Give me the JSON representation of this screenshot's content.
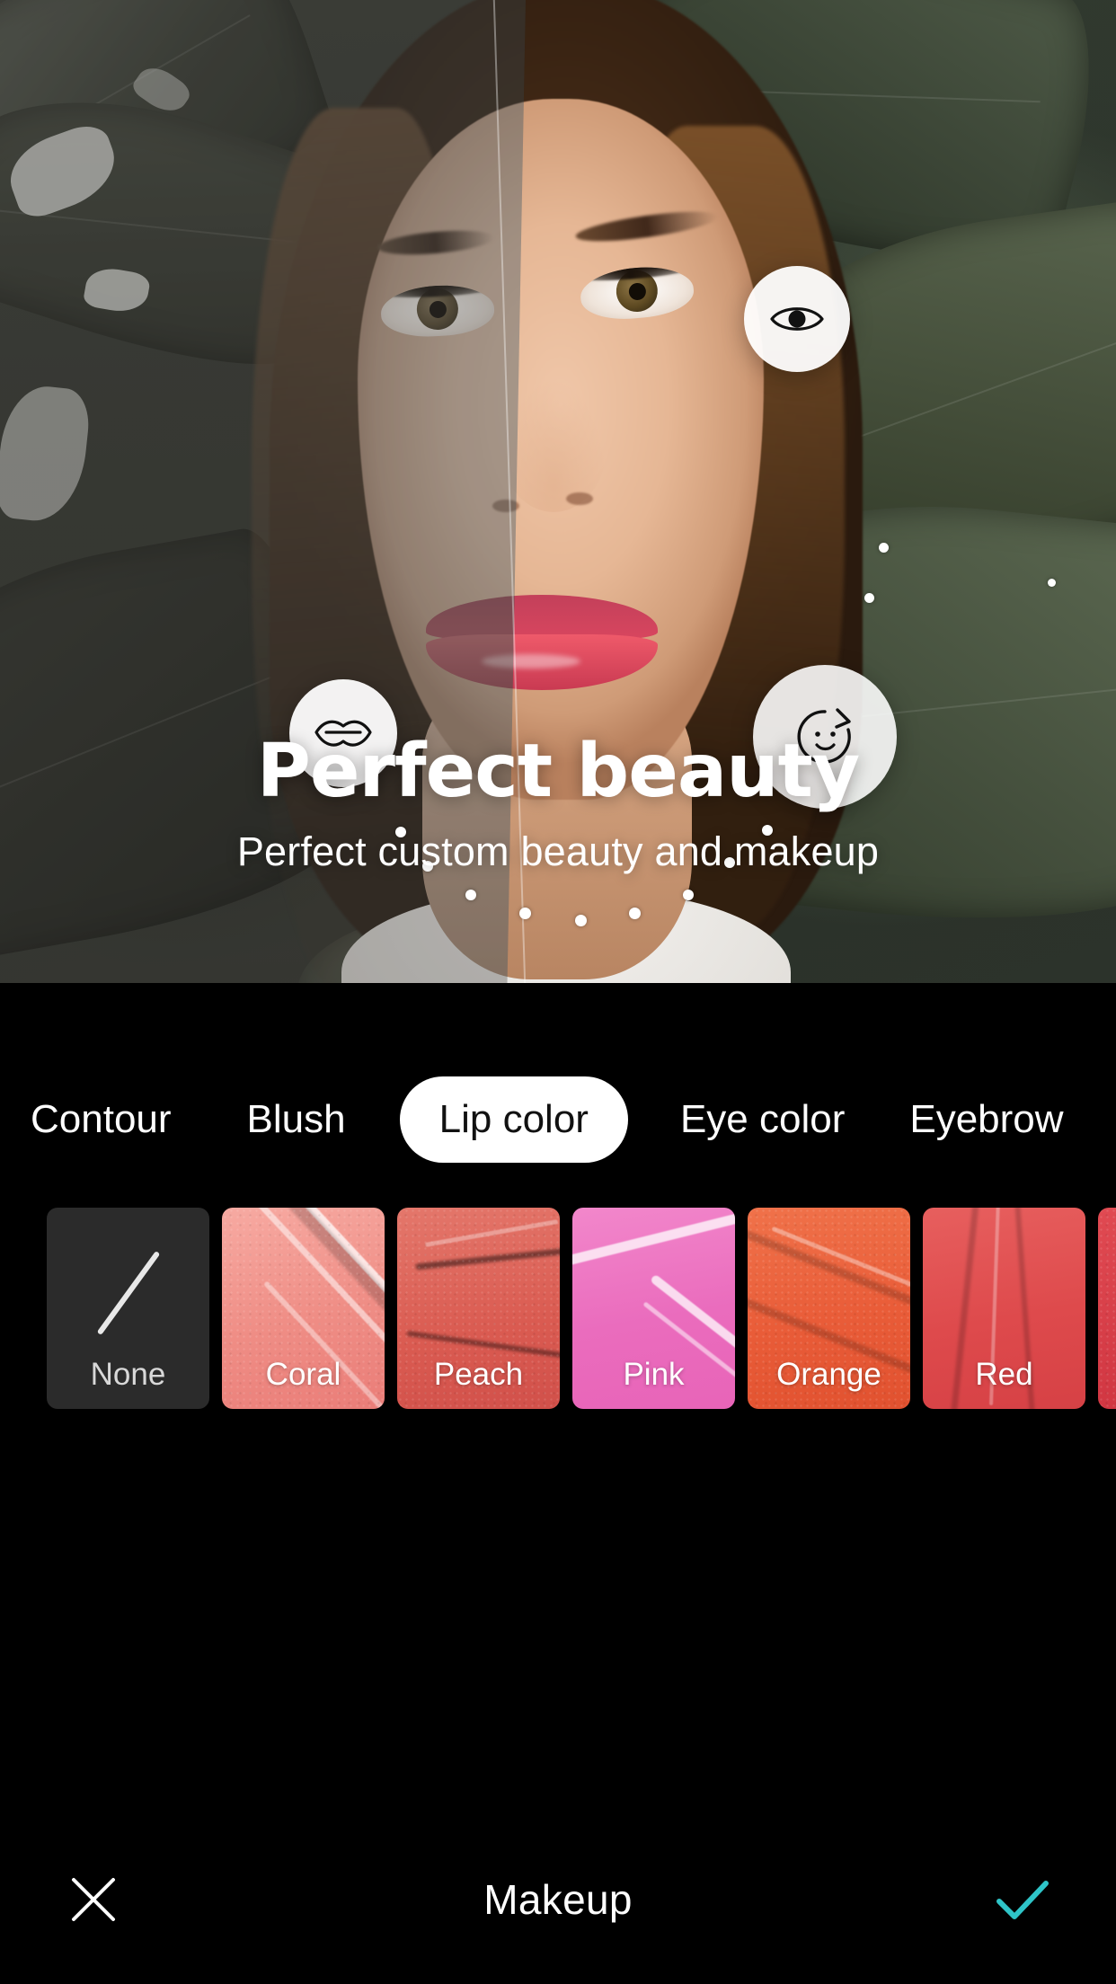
{
  "hero": {
    "headline": "Perfect beauty",
    "subhead": "Perfect custom beauty and makeup",
    "tools": [
      {
        "name": "eye-tool",
        "icon": "eye-icon"
      },
      {
        "name": "lips-tool",
        "icon": "lips-icon"
      },
      {
        "name": "rotate-tool",
        "icon": "rotate-icon"
      }
    ],
    "split_preview": "before-after-split"
  },
  "panel": {
    "tabs": [
      {
        "label": "Contour",
        "selected": false
      },
      {
        "label": "Blush",
        "selected": false
      },
      {
        "label": "Lip color",
        "selected": true
      },
      {
        "label": "Eye color",
        "selected": false
      },
      {
        "label": "Eyebrow",
        "selected": false
      }
    ],
    "swatches": [
      {
        "label": "None",
        "color": "#2b2b2b",
        "kind": "none"
      },
      {
        "label": "Coral",
        "color": "#f0978f",
        "kind": "texture"
      },
      {
        "label": "Peach",
        "color": "#e2655c",
        "kind": "texture"
      },
      {
        "label": "Pink",
        "color": "#ef7dc4",
        "kind": "texture"
      },
      {
        "label": "Orange",
        "color": "#ed6240",
        "kind": "texture"
      },
      {
        "label": "Red",
        "color": "#e2504f",
        "kind": "texture"
      },
      {
        "label": "",
        "color": "#d93a46",
        "kind": "texture"
      }
    ]
  },
  "bottombar": {
    "title": "Makeup",
    "close_label": "close-icon",
    "confirm_label": "check-icon",
    "confirm_color": "#2ec4c8"
  }
}
